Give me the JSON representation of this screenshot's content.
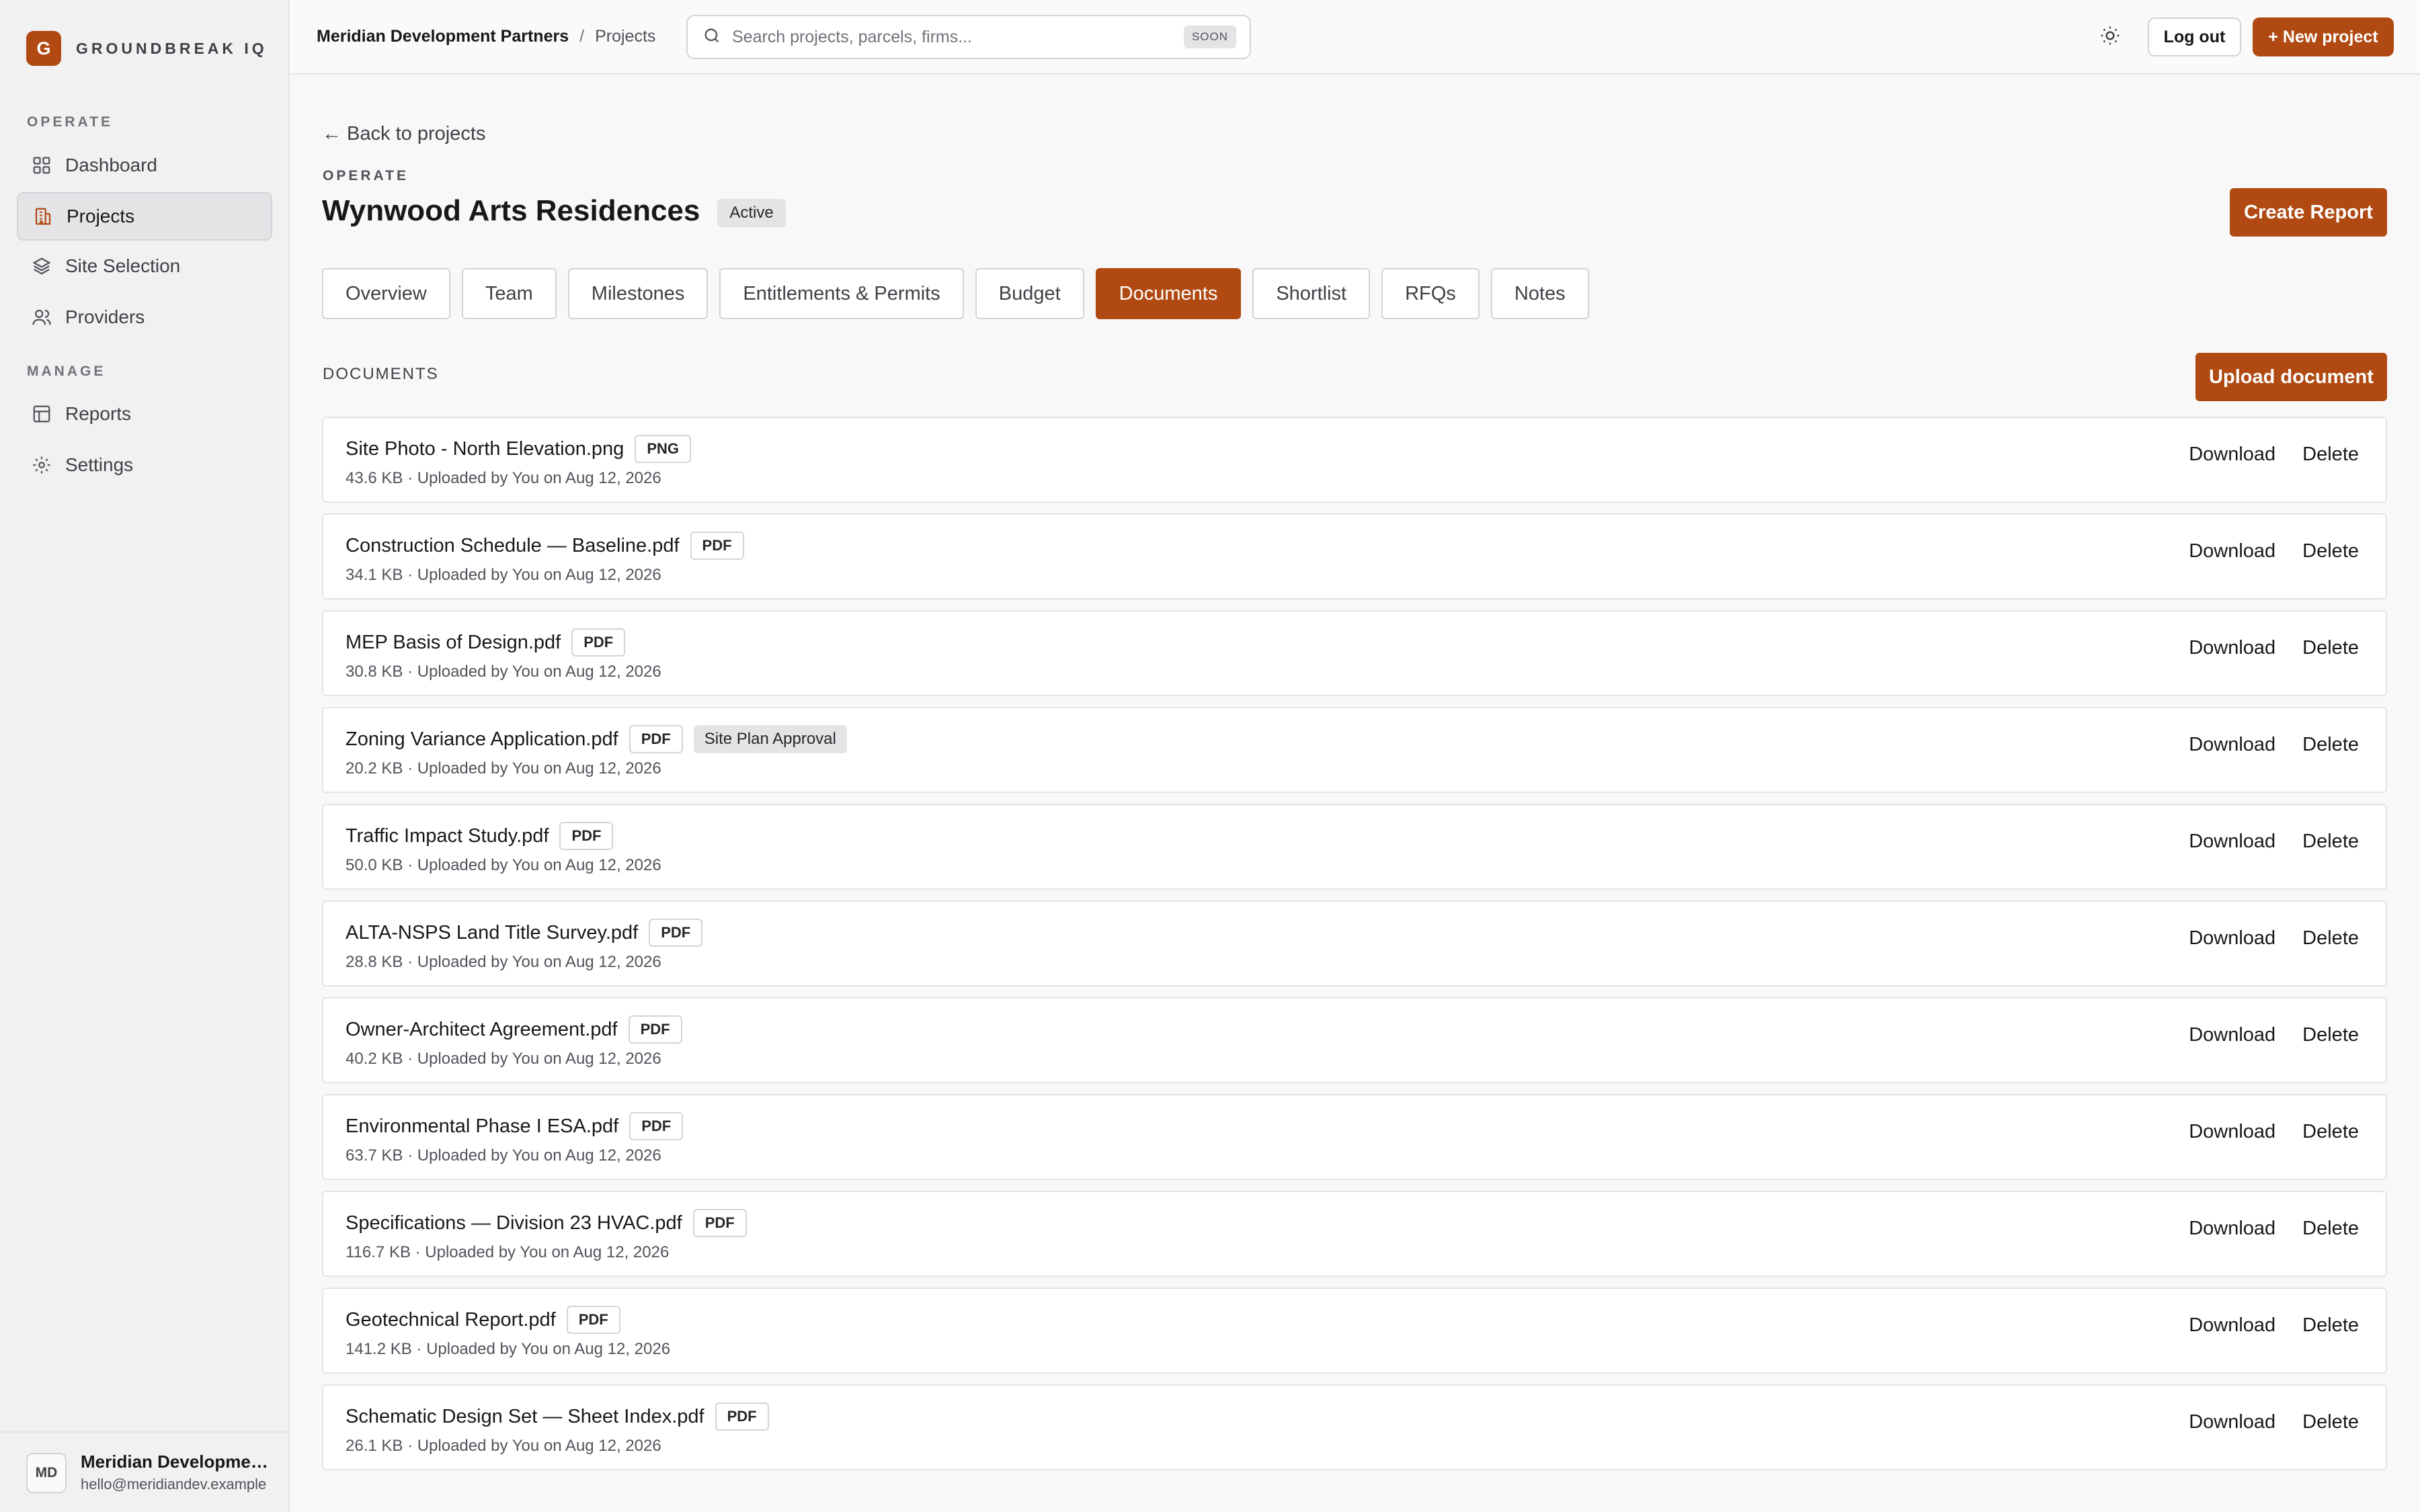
{
  "brand": {
    "logo_letter": "G",
    "name": "GROUNDBREAK IQ"
  },
  "sidebar": {
    "operate_label": "OPERATE",
    "manage_label": "MANAGE",
    "items": [
      {
        "label": "Dashboard",
        "icon": "grid-icon"
      },
      {
        "label": "Projects",
        "icon": "building-icon"
      },
      {
        "label": "Site Selection",
        "icon": "layers-icon"
      },
      {
        "label": "Providers",
        "icon": "users-icon"
      },
      {
        "label": "Reports",
        "icon": "table-icon"
      },
      {
        "label": "Settings",
        "icon": "gear-icon"
      }
    ],
    "user": {
      "initials": "MD",
      "name": "Meridian Development Partners",
      "email": "hello@meridiandev.example"
    }
  },
  "topbar": {
    "org": "Meridian Development Partners",
    "separator": "/",
    "current": "Projects",
    "search_placeholder": "Search projects, parcels, firms...",
    "search_badge": "SOON",
    "logout_label": "Log out",
    "new_project_label": "+ New project"
  },
  "page": {
    "back_label": "← Back to projects",
    "eyebrow": "OPERATE",
    "title": "Wynwood Arts Residences",
    "status": "Active",
    "create_report_label": "Create Report",
    "tabs": [
      "Overview",
      "Team",
      "Milestones",
      "Entitlements & Permits",
      "Budget",
      "Documents",
      "Shortlist",
      "RFQs",
      "Notes"
    ],
    "active_tab": "Documents",
    "section_label": "DOCUMENTS",
    "upload_label": "Upload document",
    "download_label": "Download",
    "delete_label": "Delete"
  },
  "documents": [
    {
      "name": "Site Photo - North Elevation.png",
      "type": "PNG",
      "tag": "",
      "meta": "43.6 KB · Uploaded by You on Aug 12, 2026"
    },
    {
      "name": "Construction Schedule — Baseline.pdf",
      "type": "PDF",
      "tag": "",
      "meta": "34.1 KB · Uploaded by You on Aug 12, 2026"
    },
    {
      "name": "MEP Basis of Design.pdf",
      "type": "PDF",
      "tag": "",
      "meta": "30.8 KB · Uploaded by You on Aug 12, 2026"
    },
    {
      "name": "Zoning Variance Application.pdf",
      "type": "PDF",
      "tag": "Site Plan Approval",
      "meta": "20.2 KB · Uploaded by You on Aug 12, 2026"
    },
    {
      "name": "Traffic Impact Study.pdf",
      "type": "PDF",
      "tag": "",
      "meta": "50.0 KB · Uploaded by You on Aug 12, 2026"
    },
    {
      "name": "ALTA-NSPS Land Title Survey.pdf",
      "type": "PDF",
      "tag": "",
      "meta": "28.8 KB · Uploaded by You on Aug 12, 2026"
    },
    {
      "name": "Owner-Architect Agreement.pdf",
      "type": "PDF",
      "tag": "",
      "meta": "40.2 KB · Uploaded by You on Aug 12, 2026"
    },
    {
      "name": "Environmental Phase I ESA.pdf",
      "type": "PDF",
      "tag": "",
      "meta": "63.7 KB · Uploaded by You on Aug 12, 2026"
    },
    {
      "name": "Specifications — Division 23 HVAC.pdf",
      "type": "PDF",
      "tag": "",
      "meta": "116.7 KB · Uploaded by You on Aug 12, 2026"
    },
    {
      "name": "Geotechnical Report.pdf",
      "type": "PDF",
      "tag": "",
      "meta": "141.2 KB · Uploaded by You on Aug 12, 2026"
    },
    {
      "name": "Schematic Design Set — Sheet Index.pdf",
      "type": "PDF",
      "tag": "",
      "meta": "26.1 KB · Uploaded by You on Aug 12, 2026"
    }
  ],
  "colors": {
    "accent": "#b04a12",
    "sidebar_bg": "#f1f1f2",
    "page_bg": "#f8f8f9"
  }
}
